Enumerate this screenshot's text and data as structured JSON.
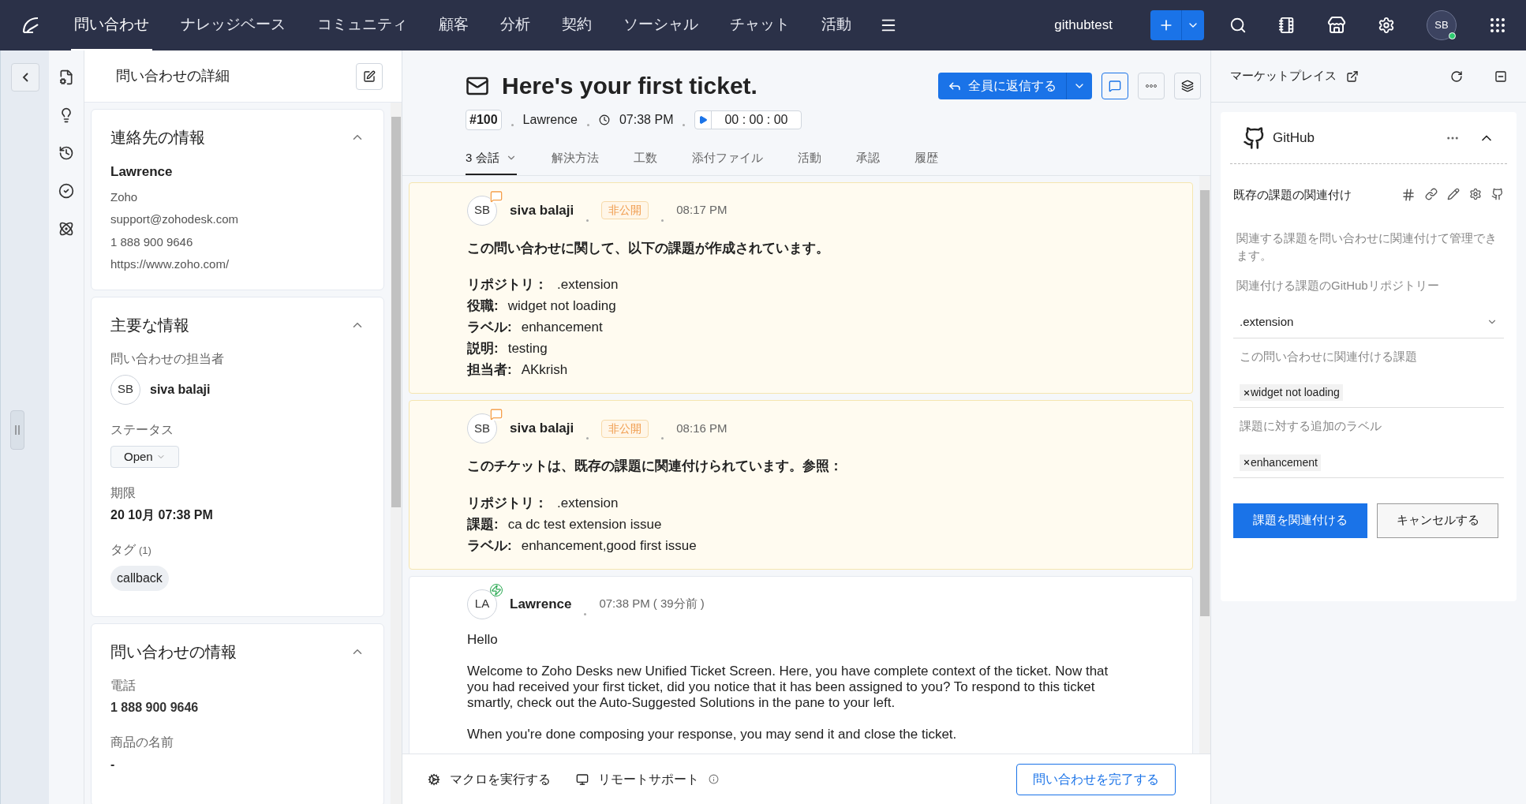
{
  "nav": {
    "items": [
      {
        "label": "問い合わせ",
        "selected": true
      },
      {
        "label": "ナレッジベース",
        "selected": false
      },
      {
        "label": "コミュニティ",
        "selected": false
      },
      {
        "label": "顧客",
        "selected": false
      },
      {
        "label": "分析",
        "selected": false
      },
      {
        "label": "契約",
        "selected": false
      },
      {
        "label": "ソーシャル",
        "selected": false
      },
      {
        "label": "チャット",
        "selected": false
      },
      {
        "label": "活動",
        "selected": false
      }
    ],
    "org": "githubtest",
    "avatar": "SB",
    "online": true
  },
  "details": {
    "title": "問い合わせの詳細",
    "contact": {
      "title": "連絡先の情報",
      "name": "Lawrence",
      "company": "Zoho",
      "email": "support@zohodesk.com",
      "phone": "1 888 900 9646",
      "website": "https://www.zoho.com/",
      "expanded": true
    },
    "key_info": {
      "title": "主要な情報",
      "expanded": true,
      "owner_label": "問い合わせの担当者",
      "owner_initials": "SB",
      "owner_name": "siva balaji",
      "status_label": "ステータス",
      "status": "Open",
      "due_label": "期限",
      "due": "20 10月 07:38 PM",
      "tags_label": "タグ",
      "tags_count": "(1)",
      "tags": [
        "callback"
      ]
    },
    "ticket_info": {
      "title": "問い合わせの情報",
      "expanded": true,
      "fields": [
        {
          "label": "電話",
          "value": "1 888 900 9646"
        },
        {
          "label": "商品の名前",
          "value": "-"
        }
      ]
    }
  },
  "ticket": {
    "subject": "Here's your first ticket.",
    "number": "#100",
    "contact": "Lawrence",
    "time": "07:38 PM",
    "timer": "00 : 00 : 00",
    "reply_button": "全員に返信する"
  },
  "tabs": [
    {
      "label": "3 会話",
      "selected": true,
      "menu": true
    },
    {
      "label": "解決方法",
      "selected": false,
      "menu": false
    },
    {
      "label": "工数",
      "selected": false,
      "menu": false
    },
    {
      "label": "添付ファイル",
      "selected": false,
      "menu": false
    },
    {
      "label": "活動",
      "selected": false,
      "menu": false
    },
    {
      "label": "承認",
      "selected": false,
      "menu": false
    },
    {
      "label": "履歴",
      "selected": false,
      "menu": false
    }
  ],
  "threads": [
    {
      "kind": "note",
      "initials": "SB",
      "author": "siva balaji",
      "badge": "非公開",
      "time": "08:17 PM",
      "heading": "この問い合わせに関して、以下の課題が作成されています。",
      "fields": [
        {
          "label": "リポジトリ：",
          "value": ".extension"
        },
        {
          "label": "役職:",
          "value": "widget not loading"
        },
        {
          "label": "ラベル:",
          "value": "enhancement"
        },
        {
          "label": "説明:",
          "value": "testing"
        },
        {
          "label": "担当者:",
          "value": "AKkrish"
        }
      ]
    },
    {
      "kind": "note",
      "initials": "SB",
      "author": "siva balaji",
      "badge": "非公開",
      "time": "08:16 PM",
      "heading": "このチケットは、既存の課題に関連付けられています。参照：",
      "fields": [
        {
          "label": "リポジトリ：",
          "value": ".extension"
        },
        {
          "label": "課題:",
          "value": "ca dc test extension issue"
        },
        {
          "label": "ラベル:",
          "value": "enhancement,good first issue"
        }
      ]
    },
    {
      "kind": "reply",
      "initials": "LA",
      "author": "Lawrence",
      "time": "07:38 PM ( 39分前 )",
      "paragraphs": [
        "Hello",
        "Welcome to Zoho Desks new Unified Ticket Screen. Here, you have complete context of the ticket. Now that you had received your first ticket, did you notice that it has been assigned to you? To respond to this ticket smartly, check out the Auto-Suggested Solutions in the pane to your left.",
        "When you're done composing your response, you may send it and close the ticket."
      ]
    }
  ],
  "footer": {
    "macro": "マクロを実行する",
    "remote": "リモートサポート",
    "close_button": "問い合わせを完了する"
  },
  "marketplace": {
    "title": "マーケットプレイス",
    "widget": {
      "name": "GitHub",
      "expanded": true,
      "section_title": "既存の課題の関連付け",
      "description": "関連する課題を問い合わせに関連付けて管理できます。",
      "repo_label": "関連付ける課題のGitHubリポジトリー",
      "repo_value": ".extension",
      "issue_label": "この問い合わせに関連付ける課題",
      "issue_tags": [
        "widget not loading"
      ],
      "label_label": "課題に対する追加のラベル",
      "label_tags": [
        "enhancement"
      ],
      "primary_button": "課題を関連付ける",
      "cancel_button": "キャンセルする"
    }
  }
}
